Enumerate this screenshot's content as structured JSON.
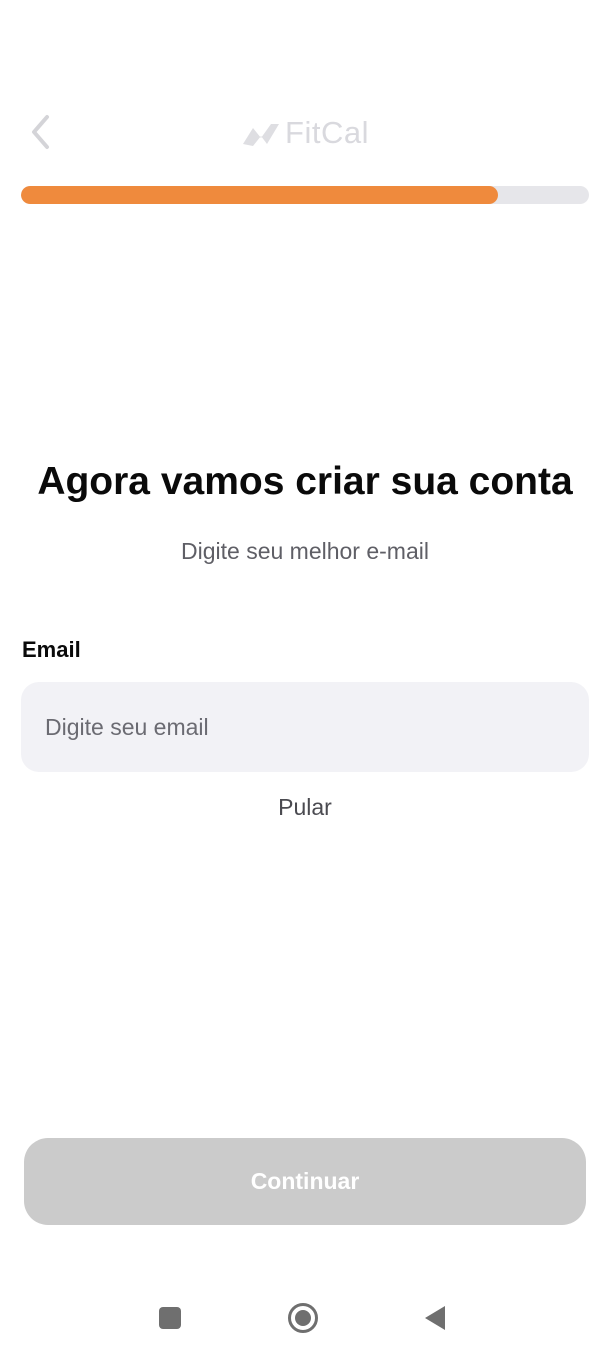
{
  "header": {
    "back_icon": "chevron-left-icon",
    "brand_icon": "fitcal-logo-icon",
    "brand_name": "FitCal"
  },
  "progress": {
    "fraction": 0.84,
    "fill_color": "#ef8a3d",
    "track_color": "#e6e6ea"
  },
  "main": {
    "title": "Agora vamos criar sua conta",
    "subtitle": "Digite seu melhor e-mail",
    "email_label": "Email",
    "email_value": "",
    "email_placeholder": "Digite seu email",
    "skip_label": "Pular"
  },
  "footer": {
    "continue_label": "Continuar",
    "continue_disabled_color": "#cbcbcb"
  },
  "system_nav": {
    "recents_icon": "square-recents-icon",
    "home_icon": "circle-home-icon",
    "back_icon": "triangle-back-icon"
  }
}
